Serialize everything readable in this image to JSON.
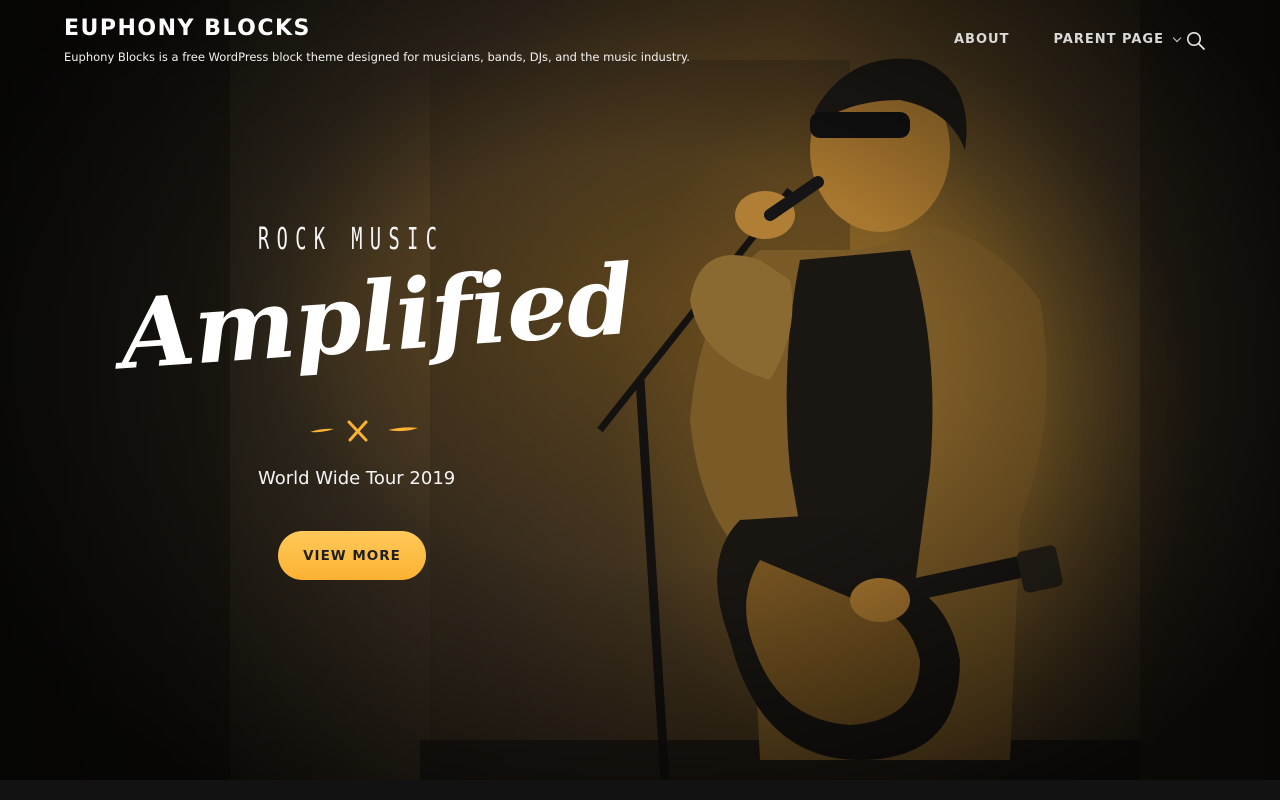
{
  "header": {
    "site_title": "EUPHONY BLOCKS",
    "tagline": "Euphony Blocks is a free WordPress block theme designed for musicians, bands, DJs, and the music industry."
  },
  "nav": {
    "items": [
      {
        "label": "ABOUT"
      },
      {
        "label": "PARENT PAGE",
        "has_submenu": true
      }
    ],
    "search_icon": "search-icon",
    "submenu_icon": "chevron-down-icon"
  },
  "hero": {
    "kicker": "ROCK MUSIC",
    "headline": "Amplified",
    "divider_icon": "crossed-drumsticks-icon",
    "subtitle": "World Wide Tour 2019",
    "cta_label": "VIEW MORE",
    "background": "duotone photo of guitarist singing into a microphone"
  },
  "colors": {
    "accent": "#fbb232",
    "accent_light": "#ffc95a",
    "text": "#ffffff",
    "nav_text": "#d9d9d9",
    "overlay": "#1a1a1a"
  }
}
